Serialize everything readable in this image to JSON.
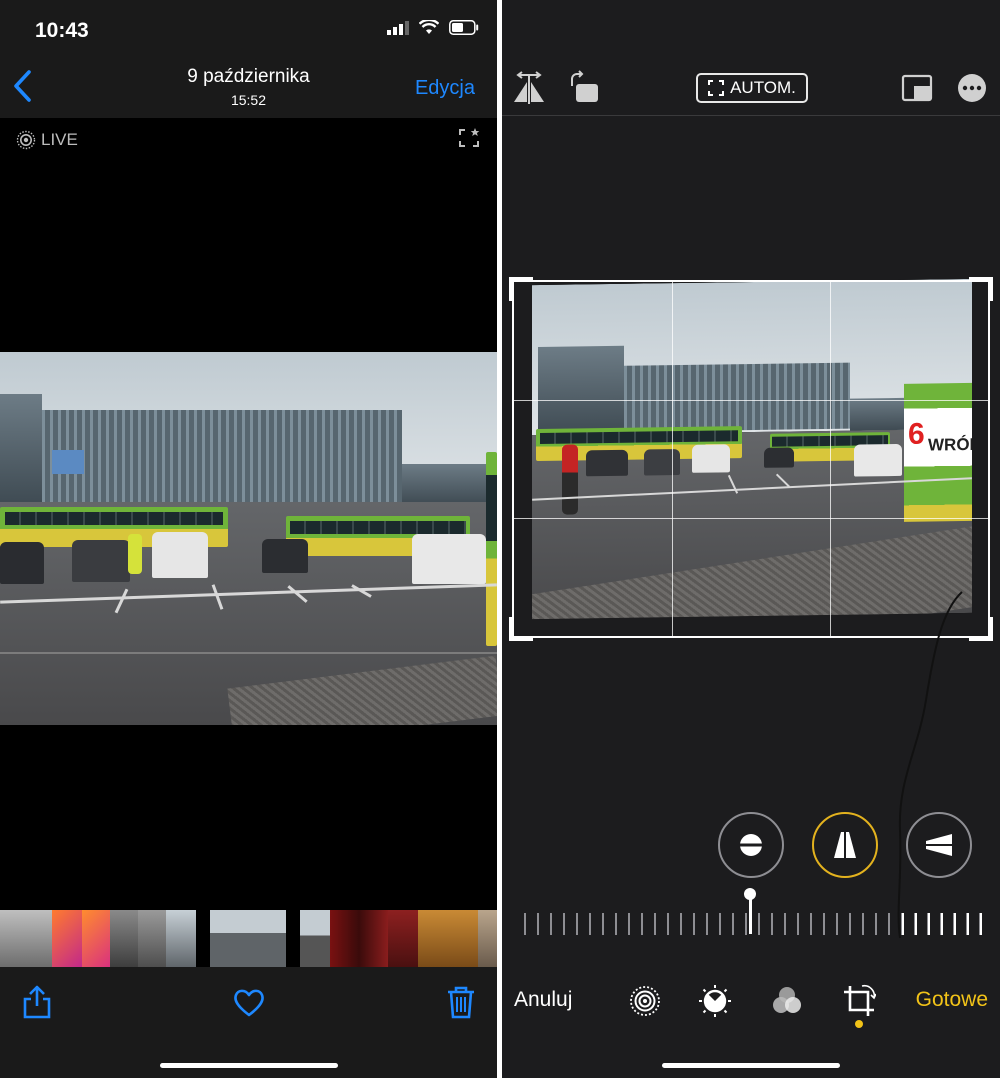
{
  "status": {
    "time": "10:43"
  },
  "viewer": {
    "title": "9 października",
    "subtitle": "15:52",
    "edit_label": "Edycja",
    "live_label": "LIVE",
    "icons": {
      "back": "chevron-left-icon",
      "live": "live-photo-icon",
      "share": "share-icon",
      "favorite": "heart-icon",
      "delete": "trash-icon"
    }
  },
  "editor": {
    "auto_label": "AUTOM.",
    "cancel_label": "Anuluj",
    "done_label": "Gotowe",
    "bus_sign": "WRÓBL",
    "bus_number": "6",
    "icons": {
      "flip": "flip-horizontal-icon",
      "rotate": "rotate-icon",
      "aspect": "aspect-ratio-icon",
      "more": "more-icon",
      "straighten": "straighten-icon",
      "vertical": "vertical-perspective-icon",
      "horizontal": "horizontal-perspective-icon",
      "live": "live-photo-icon",
      "adjust": "adjust-icon",
      "filters": "filters-icon",
      "crop": "crop-rotate-icon"
    }
  },
  "colors": {
    "accent_blue": "#1e88ff",
    "accent_yellow": "#f2c318",
    "background": "#1c1c1e"
  }
}
